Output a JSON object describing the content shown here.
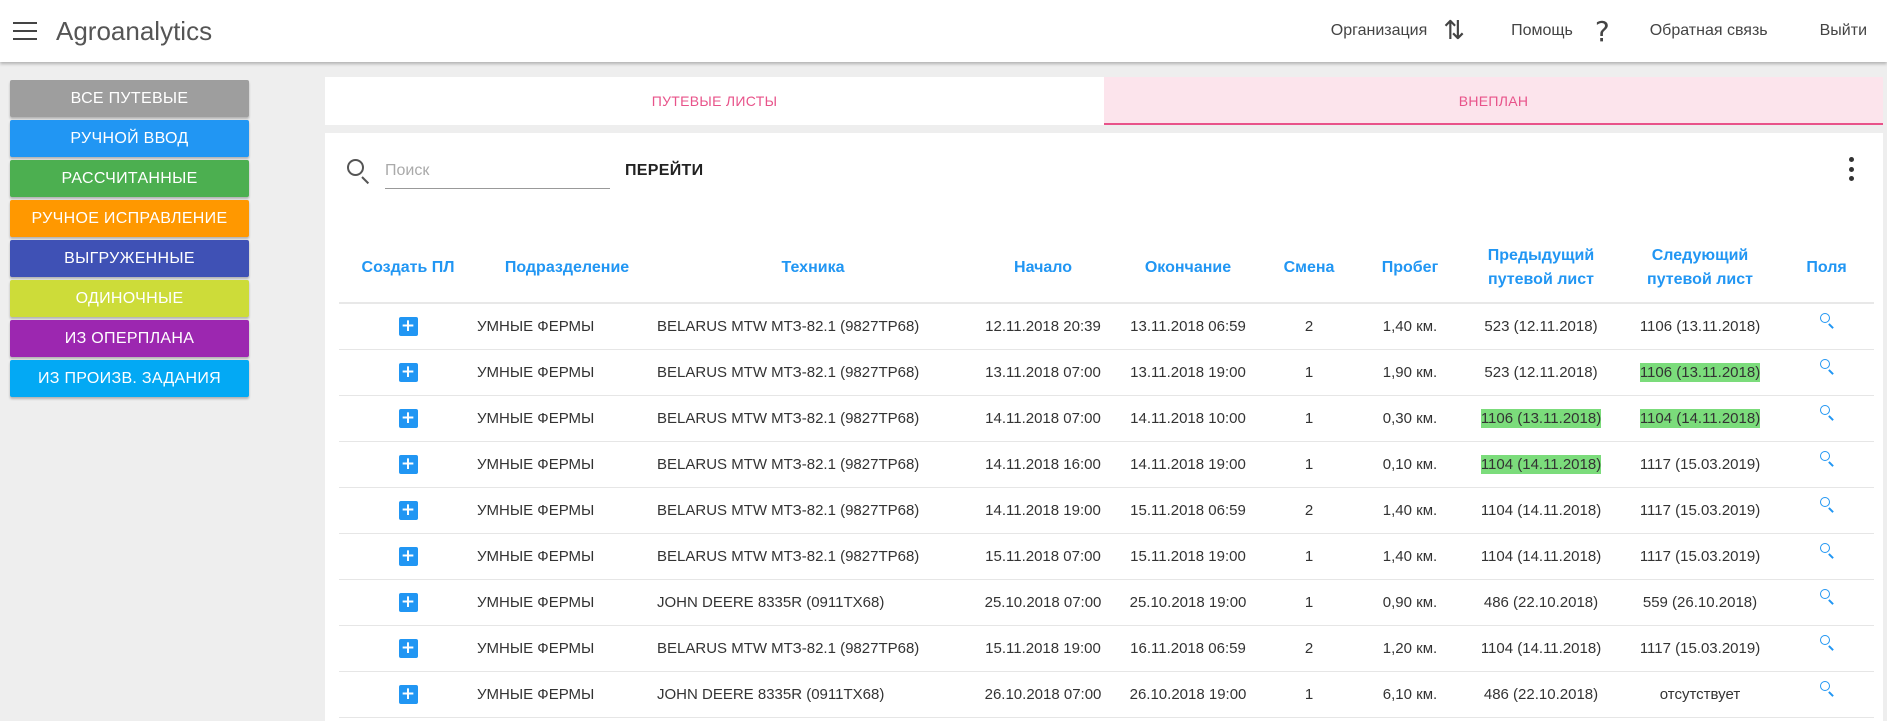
{
  "header": {
    "app_title": "Agroanalytics",
    "nav": {
      "organization": "Организация",
      "help": "Помощь",
      "feedback": "Обратная связь",
      "logout": "Выйти"
    }
  },
  "sidebar": {
    "items": [
      {
        "label": "ВСЕ ПУТЕВЫЕ",
        "color": "#9e9e9e"
      },
      {
        "label": "РУЧНОЙ ВВОД",
        "color": "#2196f3"
      },
      {
        "label": "РАССЧИТАННЫЕ",
        "color": "#4caf50"
      },
      {
        "label": "РУЧНОЕ ИСПРАВЛЕНИЕ",
        "color": "#ff9800"
      },
      {
        "label": "ВЫГРУЖЕННЫЕ",
        "color": "#3f51b5"
      },
      {
        "label": "ОДИНОЧНЫЕ",
        "color": "#cddc39"
      },
      {
        "label": "ИЗ ОПЕРПЛАНА",
        "color": "#9c27b0"
      },
      {
        "label": "ИЗ ПРОИЗВ. ЗАДАНИЯ",
        "color": "#03a9f4"
      }
    ]
  },
  "tabs": [
    {
      "label": "ПУТЕВЫЕ ЛИСТЫ",
      "active": false
    },
    {
      "label": "ВНЕПЛАН",
      "active": true
    }
  ],
  "search": {
    "placeholder": "Поиск",
    "value": "",
    "go_label": "ПЕРЕЙТИ"
  },
  "table": {
    "headers": {
      "create": "Создать ПЛ",
      "division": "Подразделение",
      "machine": "Техника",
      "start": "Начало",
      "end": "Окончание",
      "shift": "Смена",
      "mileage": "Пробег",
      "prev_line1": "Предыдущий",
      "prev_line2": "путевой лист",
      "next_line1": "Следующий",
      "next_line2": "путевой лист",
      "fields": "Поля"
    },
    "rows": [
      {
        "division": "УМНЫЕ ФЕРМЫ",
        "machine": "BELARUS MTW МТЗ-82.1 (9827ТР68)",
        "start": "12.11.2018 20:39",
        "end": "13.11.2018 06:59",
        "shift": "2",
        "mileage": "1,40 км.",
        "prev": "523 (12.11.2018)",
        "prev_hl": false,
        "next": "1106 (13.11.2018)",
        "next_hl": false
      },
      {
        "division": "УМНЫЕ ФЕРМЫ",
        "machine": "BELARUS MTW МТЗ-82.1 (9827ТР68)",
        "start": "13.11.2018 07:00",
        "end": "13.11.2018 19:00",
        "shift": "1",
        "mileage": "1,90 км.",
        "prev": "523 (12.11.2018)",
        "prev_hl": false,
        "next": "1106 (13.11.2018)",
        "next_hl": true
      },
      {
        "division": "УМНЫЕ ФЕРМЫ",
        "machine": "BELARUS MTW МТЗ-82.1 (9827ТР68)",
        "start": "14.11.2018 07:00",
        "end": "14.11.2018 10:00",
        "shift": "1",
        "mileage": "0,30 км.",
        "prev": "1106 (13.11.2018)",
        "prev_hl": true,
        "next": "1104 (14.11.2018)",
        "next_hl": true
      },
      {
        "division": "УМНЫЕ ФЕРМЫ",
        "machine": "BELARUS MTW МТЗ-82.1 (9827ТР68)",
        "start": "14.11.2018 16:00",
        "end": "14.11.2018 19:00",
        "shift": "1",
        "mileage": "0,10 км.",
        "prev": "1104 (14.11.2018)",
        "prev_hl": true,
        "next": "1117 (15.03.2019)",
        "next_hl": false
      },
      {
        "division": "УМНЫЕ ФЕРМЫ",
        "machine": "BELARUS MTW МТЗ-82.1 (9827ТР68)",
        "start": "14.11.2018 19:00",
        "end": "15.11.2018 06:59",
        "shift": "2",
        "mileage": "1,40 км.",
        "prev": "1104 (14.11.2018)",
        "prev_hl": false,
        "next": "1117 (15.03.2019)",
        "next_hl": false
      },
      {
        "division": "УМНЫЕ ФЕРМЫ",
        "machine": "BELARUS MTW МТЗ-82.1 (9827ТР68)",
        "start": "15.11.2018 07:00",
        "end": "15.11.2018 19:00",
        "shift": "1",
        "mileage": "1,40 км.",
        "prev": "1104 (14.11.2018)",
        "prev_hl": false,
        "next": "1117 (15.03.2019)",
        "next_hl": false
      },
      {
        "division": "УМНЫЕ ФЕРМЫ",
        "machine": "JOHN DEERE 8335R (0911ТХ68)",
        "start": "25.10.2018 07:00",
        "end": "25.10.2018 19:00",
        "shift": "1",
        "mileage": "0,90 км.",
        "prev": "486 (22.10.2018)",
        "prev_hl": false,
        "next": "559 (26.10.2018)",
        "next_hl": false
      },
      {
        "division": "УМНЫЕ ФЕРМЫ",
        "machine": "BELARUS MTW МТЗ-82.1 (9827ТР68)",
        "start": "15.11.2018 19:00",
        "end": "16.11.2018 06:59",
        "shift": "2",
        "mileage": "1,20 км.",
        "prev": "1104 (14.11.2018)",
        "prev_hl": false,
        "next": "1117 (15.03.2019)",
        "next_hl": false
      },
      {
        "division": "УМНЫЕ ФЕРМЫ",
        "machine": "JOHN DEERE 8335R (0911ТХ68)",
        "start": "26.10.2018 07:00",
        "end": "26.10.2018 19:00",
        "shift": "1",
        "mileage": "6,10 км.",
        "prev": "486 (22.10.2018)",
        "prev_hl": false,
        "next": "отсутствует",
        "next_hl": false
      }
    ]
  },
  "icons": {
    "menu": "hamburger-icon",
    "organization": "swap-arrows-icon",
    "help": "question-icon",
    "search": "search-icon",
    "more": "kebab-icon",
    "create": "plus-icon",
    "fields": "magnifier-icon"
  }
}
